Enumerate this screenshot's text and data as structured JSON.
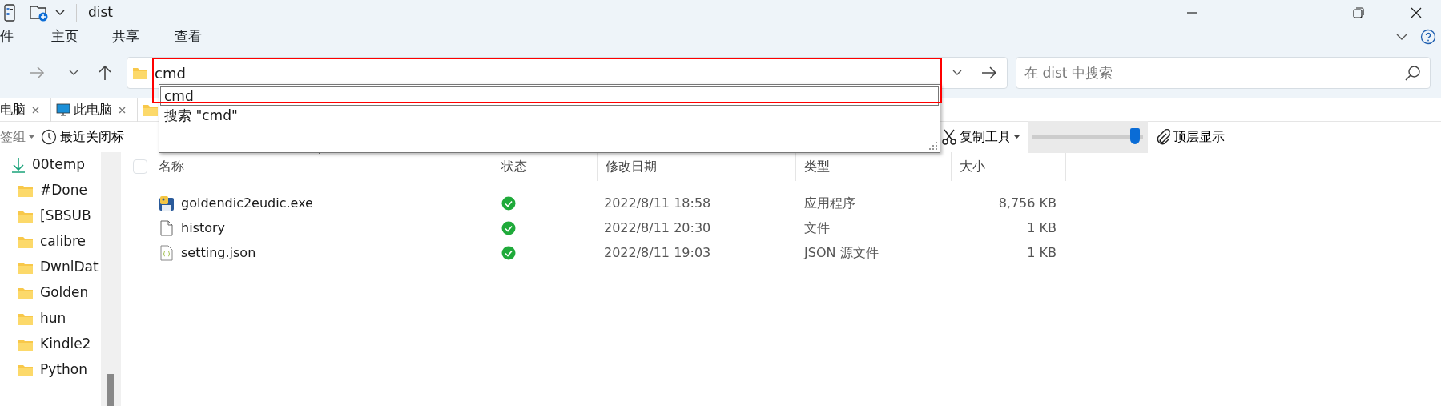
{
  "window": {
    "title": "dist"
  },
  "ribbon_tabs": [
    {
      "label": "件"
    },
    {
      "label": "主页"
    },
    {
      "label": "共享"
    },
    {
      "label": "查看"
    }
  ],
  "address_bar": {
    "value": "cmd",
    "highlighted": true,
    "suggestions": [
      {
        "label": "cmd",
        "selected": true
      },
      {
        "label": "搜索 \"cmd\"",
        "selected": false
      }
    ]
  },
  "search": {
    "placeholder": "在 dist 中搜索"
  },
  "tabs": [
    {
      "label": "电脑",
      "kind": "plain"
    },
    {
      "label": "此电脑",
      "kind": "computer"
    }
  ],
  "toolbar": {
    "left": [
      {
        "label": "签组",
        "kind": "group"
      },
      {
        "label": "最近关闭标",
        "kind": "recent"
      }
    ],
    "right": [
      {
        "label": "复制工具",
        "kind": "copy"
      },
      {
        "kind": "slider",
        "level": 0.93
      },
      {
        "label": "顶层显示",
        "kind": "pin"
      }
    ]
  },
  "sidebar": {
    "items": [
      {
        "label": "00temp",
        "kind": "download"
      },
      {
        "label": "#Done",
        "kind": "folder"
      },
      {
        "label": "[SBSUB",
        "kind": "folder"
      },
      {
        "label": "calibre",
        "kind": "folder"
      },
      {
        "label": "DwnlDat",
        "kind": "folder"
      },
      {
        "label": "Golden",
        "kind": "folder"
      },
      {
        "label": "hun",
        "kind": "folder"
      },
      {
        "label": "Kindle2",
        "kind": "folder"
      },
      {
        "label": "Python",
        "kind": "folder"
      }
    ]
  },
  "table": {
    "select_all": {
      "checked": false
    },
    "columns": [
      "名称",
      "状态",
      "修改日期",
      "类型",
      "大小"
    ],
    "rows": [
      {
        "kind": "exe",
        "name": "goldendic2eudic.exe",
        "synced": true,
        "modified": "2022/8/11 18:58",
        "type": "应用程序",
        "size": "8,756 KB"
      },
      {
        "kind": "file",
        "name": "history",
        "synced": true,
        "modified": "2022/8/11 20:30",
        "type": "文件",
        "size": "1 KB"
      },
      {
        "kind": "json",
        "name": "setting.json",
        "synced": true,
        "modified": "2022/8/11 19:03",
        "type": "JSON 源文件",
        "size": "1 KB"
      }
    ]
  }
}
